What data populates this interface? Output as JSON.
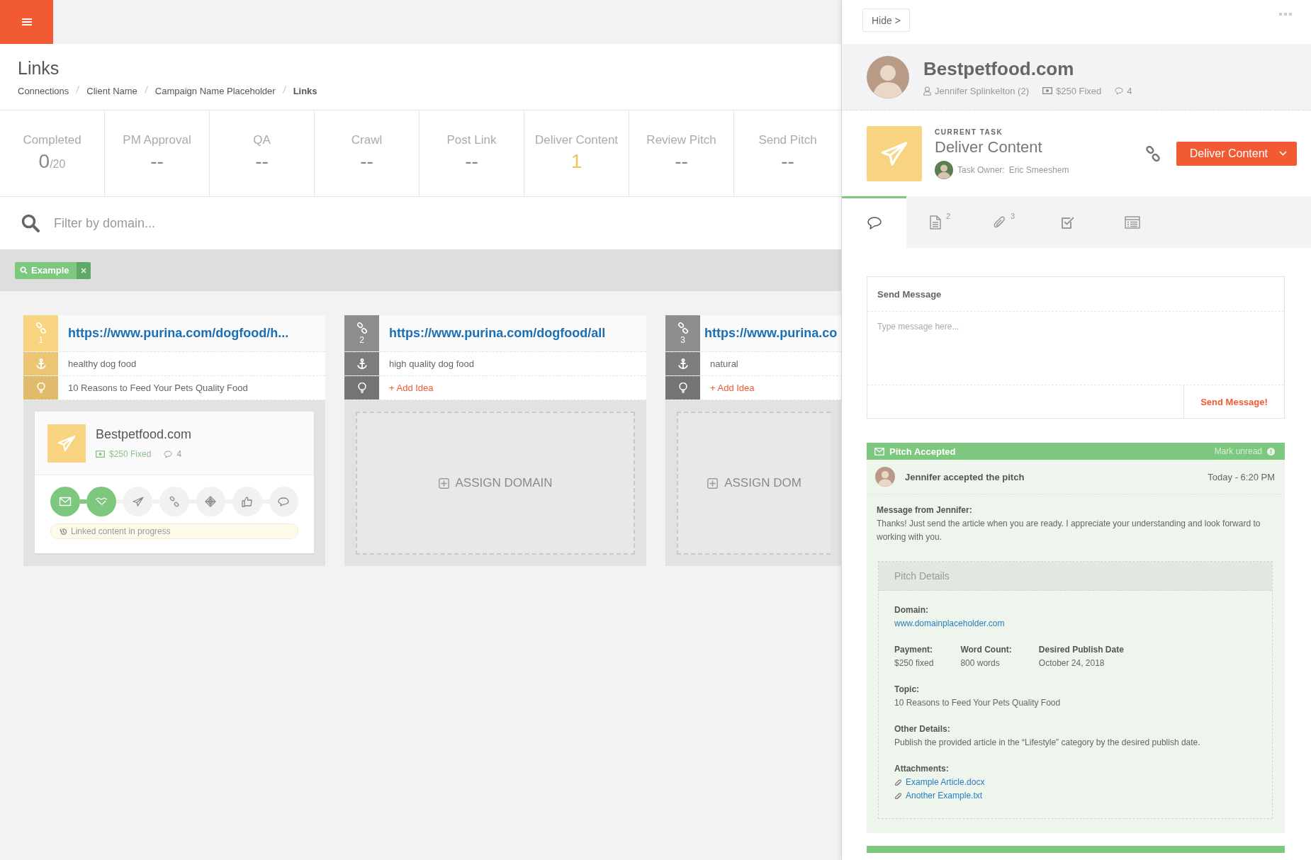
{
  "page": {
    "title": "Links",
    "breadcrumb": [
      {
        "label": "Connections",
        "current": false
      },
      {
        "label": "Client Name",
        "current": false
      },
      {
        "label": "Campaign Name Placeholder",
        "current": false
      },
      {
        "label": "Links",
        "current": true
      }
    ]
  },
  "stats": [
    {
      "label": "Completed",
      "value": "0",
      "total": "/20",
      "active": false
    },
    {
      "label": "PM Approval",
      "value": "--",
      "active": false
    },
    {
      "label": "QA",
      "value": "--",
      "active": false
    },
    {
      "label": "Crawl",
      "value": "--",
      "active": false
    },
    {
      "label": "Post Link",
      "value": "--",
      "active": false
    },
    {
      "label": "Deliver Content",
      "value": "1",
      "active": true
    },
    {
      "label": "Review Pitch",
      "value": "--",
      "active": false
    },
    {
      "label": "Send Pitch",
      "value": "--",
      "active": false
    }
  ],
  "filter": {
    "placeholder": "Filter by domain..."
  },
  "tags": [
    {
      "label": "Example"
    }
  ],
  "links": [
    {
      "number": "1",
      "url": "https://www.purina.com/dogfood/h...",
      "anchor": "healthy dog food",
      "idea": "10 Reasons to Feed Your Pets Quality Food",
      "assigned": true,
      "assignment": {
        "domain": "Bestpetfood.com",
        "price": "$250 Fixed",
        "comments": "4",
        "stages": [
          {
            "done": true
          },
          {
            "done": true
          },
          {
            "done": false
          },
          {
            "done": false
          },
          {
            "done": false
          },
          {
            "done": false
          },
          {
            "done": false
          }
        ],
        "status": "Linked content in progress"
      }
    },
    {
      "number": "2",
      "url": "https://www.purina.com/dogfood/all",
      "anchor": "high quality dog food",
      "add_idea": "+ Add Idea",
      "assigned": false,
      "assign_label": "ASSIGN DOMAIN"
    },
    {
      "number": "3",
      "url": "https://www.purina.co",
      "anchor": "natural",
      "add_idea": "+ Add Idea",
      "assigned": false,
      "assign_label": "ASSIGN DOM"
    }
  ],
  "panel": {
    "hide_button": "Hide >",
    "profile": {
      "name": "Bestpetfood.com",
      "contact": "Jennifer Splinkelton (2)",
      "price": "$250 Fixed",
      "comments": "4"
    },
    "task": {
      "caption": "CURRENT TASK",
      "name": "Deliver Content",
      "owner_label": "Task Owner:",
      "owner": "Eric Smeeshem",
      "action": "Deliver Content"
    },
    "tabs": [
      {
        "selected": true
      },
      {
        "selected": false,
        "count": "2"
      },
      {
        "selected": false,
        "count": "3"
      },
      {
        "selected": false
      },
      {
        "selected": false
      }
    ],
    "composer": {
      "title": "Send Message",
      "placeholder": "Type message here...",
      "send": "Send Message!"
    },
    "activity": {
      "title": "Pitch Accepted",
      "mark_unread": "Mark unread",
      "headline": "Jennifer accepted the pitch",
      "time": "Today - 6:20 PM",
      "message_label": "Message from Jennifer:",
      "message": "Thanks! Just send the article when you are ready. I appreciate your understanding and look forward to working with you.",
      "details": {
        "title": "Pitch Details",
        "domain_label": "Domain:",
        "domain": "www.domainplaceholder.com",
        "fields": [
          {
            "label": "Payment:",
            "value": "$250 fixed"
          },
          {
            "label": "Word Count:",
            "value": "800 words"
          },
          {
            "label": "Desired Publish Date",
            "value": "October 24, 2018"
          }
        ],
        "topic_label": "Topic:",
        "topic": "10 Reasons to Feed Your Pets Quality Food",
        "other_label": "Other Details:",
        "other": "Publish the provided article in the “Lifestyle” category by the desired publish date.",
        "attachments_label": "Attachments:",
        "attachments": [
          "Example Article.docx",
          "Another Example.txt"
        ]
      }
    }
  }
}
